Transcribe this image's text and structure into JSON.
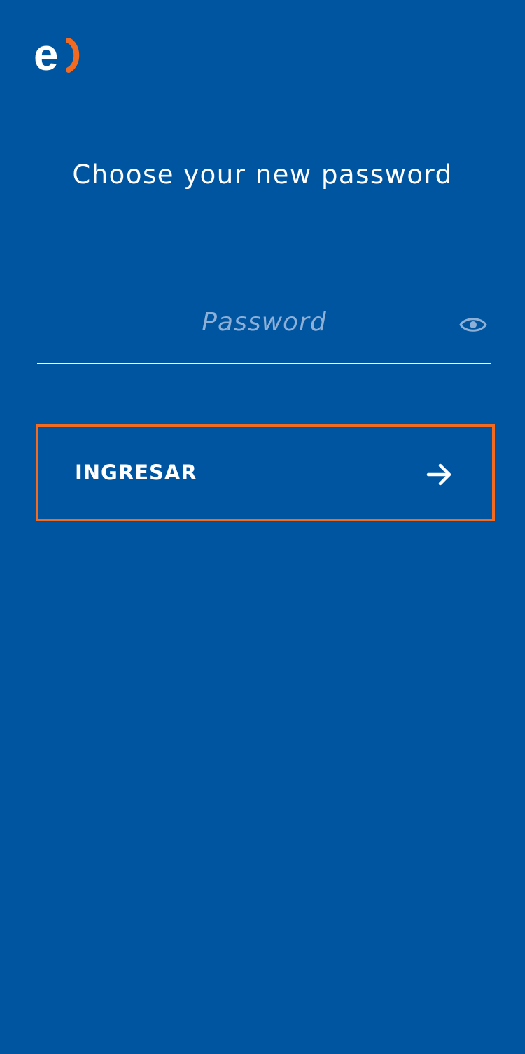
{
  "brand": {
    "logo_icon": "enel-logo-icon",
    "logo_text": "e",
    "colors": {
      "background": "#0055a1",
      "accent": "#f36b21",
      "text": "#ffffff",
      "placeholder": "#8fb0d6"
    }
  },
  "page": {
    "title": "Choose your new password"
  },
  "password": {
    "value": "",
    "placeholder": "Password",
    "toggle_icon": "eye-icon"
  },
  "submit": {
    "label": "INGRESAR",
    "icon": "arrow-right-icon"
  }
}
